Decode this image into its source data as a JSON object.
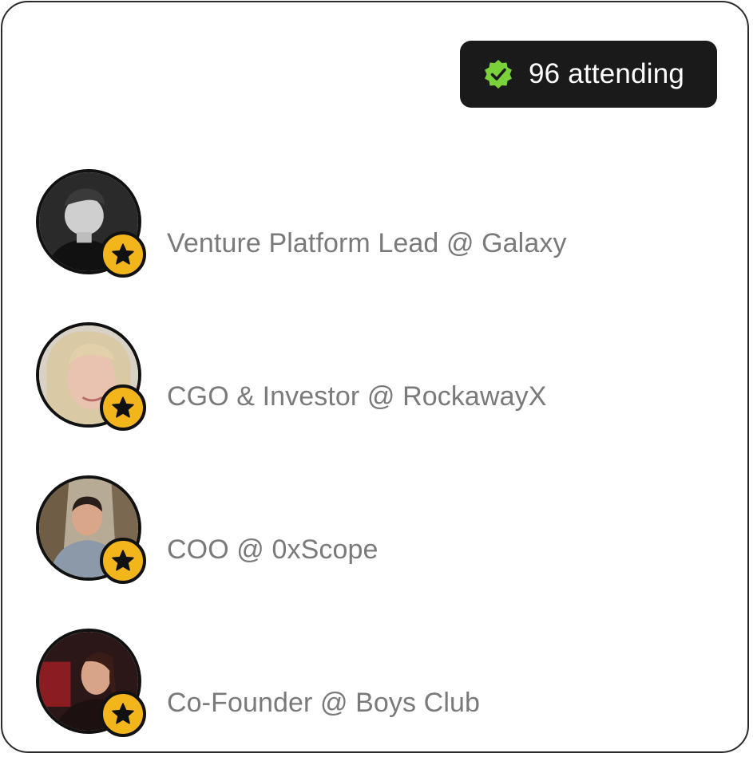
{
  "header": {
    "attending_label": "96 attending",
    "check_icon": "verified-check-icon",
    "check_color": "#7bd13a"
  },
  "attendees": [
    {
      "title": "Venture Platform Lead @ Galaxy",
      "avatar": "profile-photo",
      "badge_icon": "star-icon"
    },
    {
      "title": "CGO & Investor @ RockawayX",
      "avatar": "profile-photo",
      "badge_icon": "star-icon"
    },
    {
      "title": "COO @ 0xScope",
      "avatar": "profile-photo",
      "badge_icon": "star-icon"
    },
    {
      "title": "Co-Founder @ Boys Club",
      "avatar": "profile-photo",
      "badge_icon": "star-icon"
    }
  ],
  "colors": {
    "badge_bg": "#1a1a1a",
    "star_badge": "#f2b51c",
    "title_text": "#7a7a7a"
  }
}
